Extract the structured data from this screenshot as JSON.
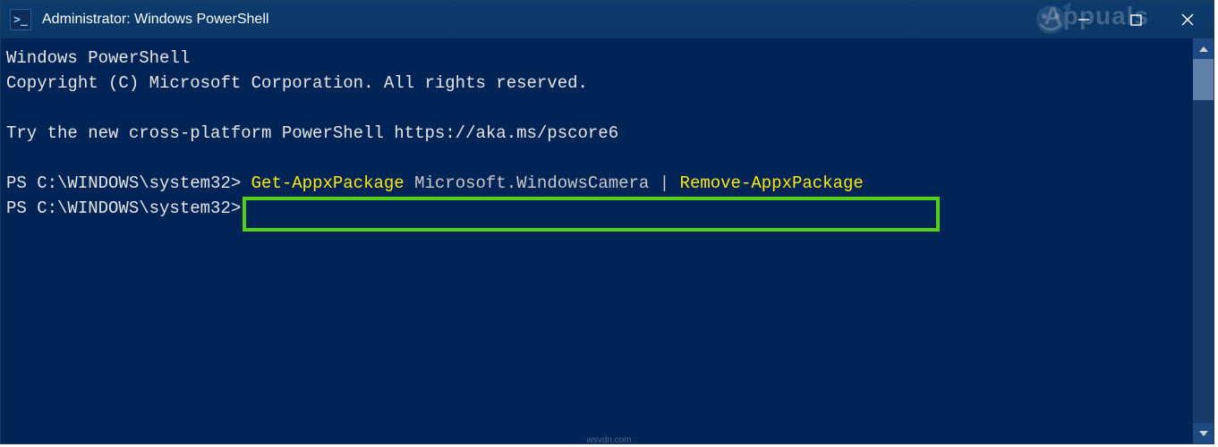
{
  "titlebar": {
    "icon_glyph": ">_",
    "title": "Administrator: Windows PowerShell"
  },
  "watermark": {
    "text": "Appuals",
    "footer": "wsvdn.com"
  },
  "terminal": {
    "line1": "Windows PowerShell",
    "line2": "Copyright (C) Microsoft Corporation. All rights reserved.",
    "line3": "Try the new cross-platform PowerShell https://aka.ms/pscore6",
    "prompt1": "PS C:\\WINDOWS\\system32>",
    "cmd_part1": "Get-AppxPackage",
    "cmd_part2": " Microsoft.WindowsCamera ",
    "cmd_pipe": "|",
    "cmd_part3": "Remove-AppxPackage",
    "prompt2": "PS C:\\WINDOWS\\system32>"
  }
}
